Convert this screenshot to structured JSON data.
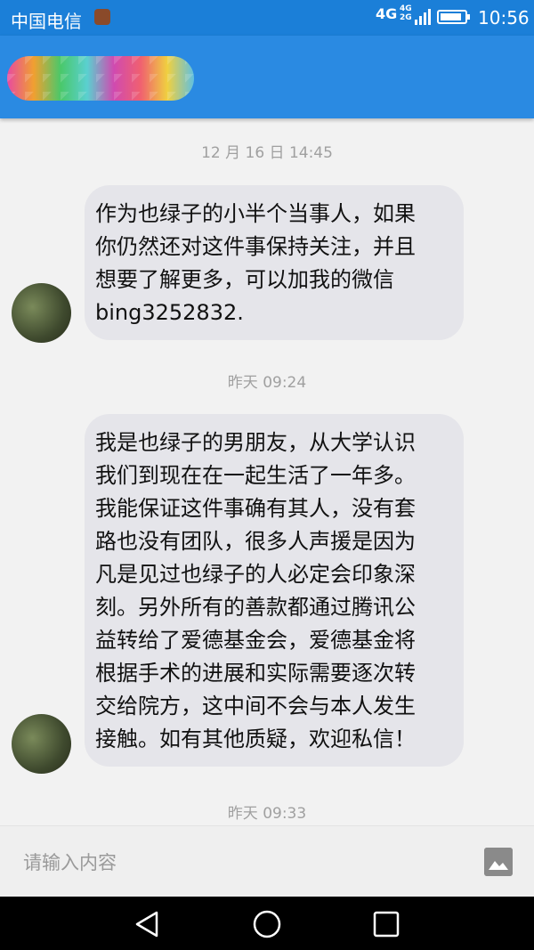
{
  "status_bar": {
    "carrier": "中国电信",
    "network": "4G",
    "network_secondary": [
      "4G",
      "2G"
    ],
    "time": "10:56",
    "battery_level": 0.9
  },
  "app_bar": {
    "title_obscured": true
  },
  "messages": [
    {
      "timestamp": "12 月 16 日 14:45",
      "lines": [
        "作为也绿子的小半个当事人，如果",
        "你仍然还对这件事保持关注，并且",
        "想要了解更多，可以加我的微信",
        "bing3252832."
      ]
    },
    {
      "timestamp": "昨天 09:24",
      "lines": [
        "我是也绿子的男朋友，从大学认识",
        "我们到现在在一起生活了一年多。",
        "我能保证这件事确有其人，没有套",
        "路也没有团队，很多人声援是因为",
        "凡是见过也绿子的人必定会印象深",
        "刻。另外所有的善款都通过腾讯公",
        "益转给了爱德基金会，爱德基金将",
        "根据手术的进展和实际需要逐次转",
        "交给院方，这中间不会与本人发生",
        "接触。如有其他质疑，欢迎私信！"
      ]
    }
  ],
  "last_timestamp": "昨天 09:33",
  "input": {
    "placeholder": "请输入内容",
    "value": ""
  },
  "icons": {
    "image": "image-icon",
    "back": "back-icon",
    "home": "home-icon",
    "recents": "recents-icon"
  },
  "colors": {
    "status_bar": "#1b7fd8",
    "app_bar": "#2a8ae2",
    "bubble": "#e5e5ea",
    "background": "#f2f2f2"
  }
}
